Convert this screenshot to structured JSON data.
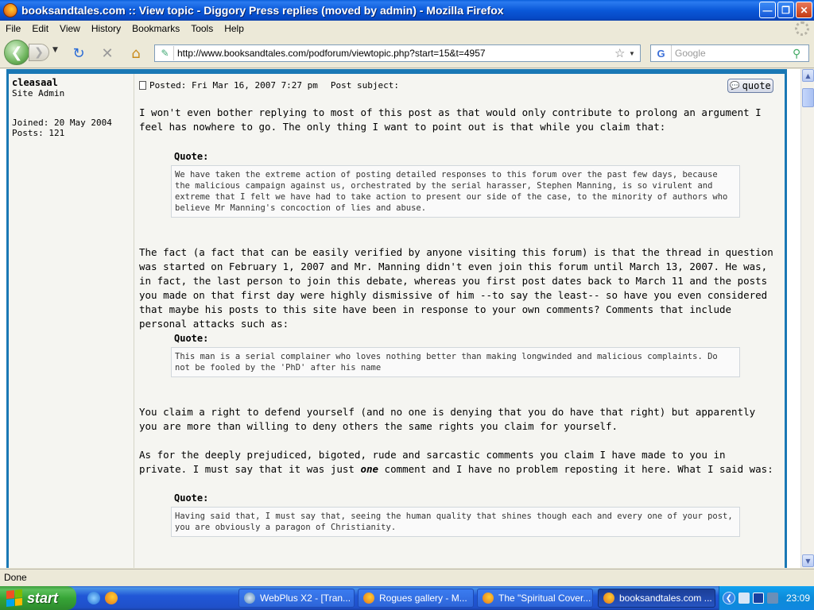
{
  "window": {
    "title": "booksandtales.com :: View topic - Diggory Press replies (moved by admin) - Mozilla Firefox"
  },
  "menu": [
    "File",
    "Edit",
    "View",
    "History",
    "Bookmarks",
    "Tools",
    "Help"
  ],
  "toolbar": {
    "url": "http://www.booksandtales.com/podforum/viewtopic.php?start=15&t=4957",
    "search_placeholder": "Google"
  },
  "author": {
    "name": "cleasaal",
    "rank": "Site Admin",
    "joined": "Joined: 20 May 2004",
    "posts": "Posts: 121"
  },
  "post": {
    "posted": "Posted: Fri Mar 16, 2007 7:27 pm",
    "subject": "Post subject:",
    "quote_button": "quote",
    "para1": "I won't even bother replying to most of this post as that would only contribute to prolong an argument I feel has nowhere to go. The only thing I want to point out is that while you claim that:",
    "quote_label": "Quote:",
    "quote1": "We have taken the extreme action of posting detailed responses to this forum over the past few days, because the malicious campaign against us, orchestrated by the serial harasser, Stephen Manning, is so virulent and extreme that I felt we have had to take action to present our side of the case, to the minority of authors who believe Mr Manning's concoction of lies and abuse.",
    "para2": "The fact (a fact that can be easily verified by anyone visiting this forum) is that the thread in question was started on February 1, 2007 and Mr. Manning didn't even join this forum until March 13, 2007. He was, in fact, the last person to join this debate, whereas you first post dates back to March 11 and the posts you made on that first day were highly dismissive of him --to say the least-- so have you even considered that maybe his posts to this site have been in response to your own comments? Comments that include personal attacks such as:",
    "quote2": "This man is a serial complainer who loves nothing better than making longwinded and malicious complaints. Do not be fooled by the 'PhD' after his name",
    "para3": "You claim a right to defend yourself (and no one is denying that you do have that right) but apparently you are more than willing to deny others the same rights you claim for yourself.",
    "para4_before": "As for the deeply prejudiced, bigoted, rude and sarcastic comments you claim I have made to you in private. I must say that it was just ",
    "para4_em": "one",
    "para4_after": " comment and I have no problem reposting it here. What I said was:",
    "quote3": "Having said that, I must say that, seeing the human quality that shines though each and every one of your post, you are obviously a paragon of Christianity."
  },
  "status": "Done",
  "taskbar": {
    "start": "start",
    "tasks": [
      "WebPlus X2 - [Tran...",
      "Rogues gallery - M...",
      "The \"Spiritual Cover...",
      "booksandtales.com ..."
    ],
    "clock": "23:09"
  }
}
